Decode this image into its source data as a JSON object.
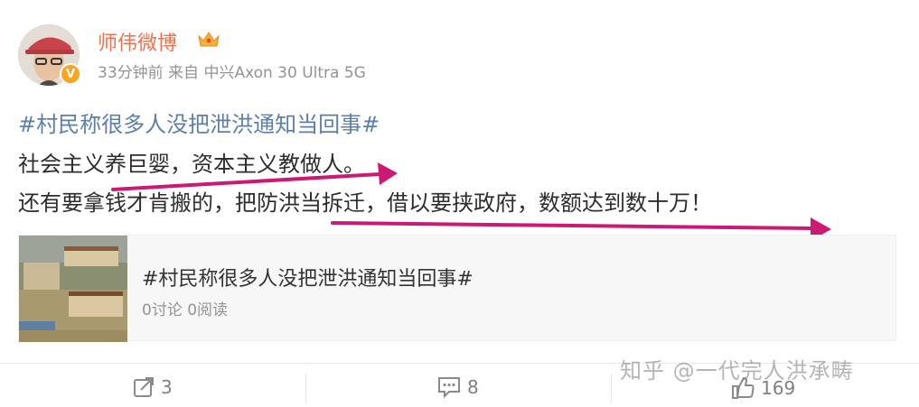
{
  "post": {
    "author": "师伟微博",
    "meta": "33分钟前 来自 中兴Axon 30 Ultra 5G",
    "hashtag": "#村民称很多人没把泄洪通知当回事#",
    "line1": "社会主义养巨婴，资本主义教做人。",
    "line2": "还有要拿钱才肯搬的，把防洪当拆迁，借以要挟政府，数额达到数十万！"
  },
  "card": {
    "title": "#村民称很多人没把泄洪通知当回事#",
    "stats": "0讨论 0阅读"
  },
  "actions": {
    "repost_count": "3",
    "comment_count": "8",
    "like_count": "169"
  },
  "watermark": "知乎 @一代完人洪承畴",
  "colors": {
    "username": "#eb7350",
    "hashtag": "#5d7fa8",
    "annotation_arrow": "#cc1a74",
    "vip_badge": "#f6a623"
  },
  "icons": [
    "verified-badge-icon",
    "crown-icon",
    "repost-icon",
    "comment-icon",
    "like-icon",
    "arrow-annotation"
  ]
}
